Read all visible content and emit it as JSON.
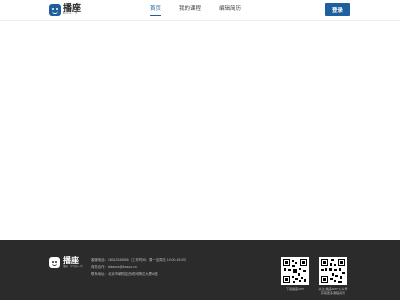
{
  "header": {
    "logo_name": "播座",
    "logo_sub": "Bozuo · 学",
    "nav": [
      "首页",
      "我的课程",
      "编辑简历"
    ],
    "active_nav": 0,
    "login_label": "登录",
    "accent": "#1f5f9e"
  },
  "footer": {
    "logo_name": "播座",
    "logo_sub": "播座 · 学习新一代",
    "info": [
      "客服电话：18012345556（工作时间：周一至周五 10:00-18:00）",
      "商务合作：kfzaoxx@bozuo.cn",
      "联系地址：北京市朝阳区西坝河腾达大厦A座"
    ],
    "qr1_caption": "下载播座APP",
    "qr2_caption_lines": [
      "关注“播座APP”公众号",
      "获取更多课程资讯"
    ],
    "background": "#2b2b2b"
  }
}
